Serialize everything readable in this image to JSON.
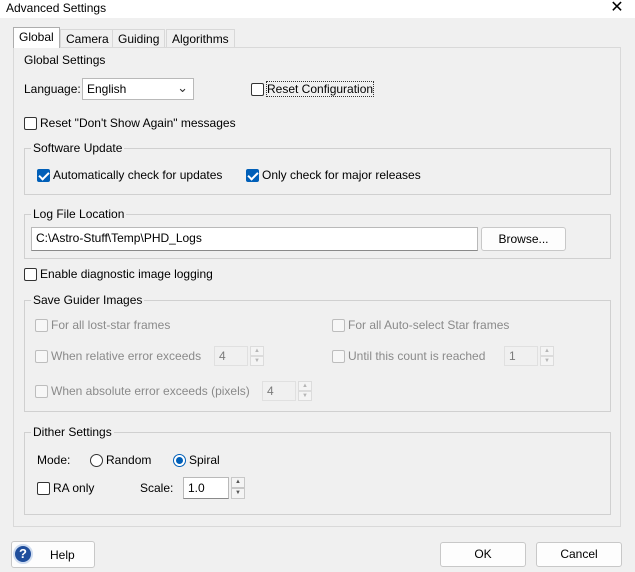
{
  "window": {
    "title": "Advanced Settings",
    "close": "✕"
  },
  "tabs": [
    "Global",
    "Camera",
    "Guiding",
    "Algorithms"
  ],
  "global_settings": {
    "label": "Global Settings",
    "language_label": "Language:",
    "language_value": "English",
    "reset_config": "Reset Configuration",
    "reset_dont_show": "Reset \"Don't Show Again\" messages"
  },
  "software_update": {
    "label": "Software Update",
    "auto_check": "Automatically check for updates",
    "major_only": "Only check for major releases"
  },
  "log_file": {
    "label": "Log File Location",
    "path": "C:\\Astro-Stuff\\Temp\\PHD_Logs",
    "browse": "Browse..."
  },
  "diagnostic": "Enable diagnostic image logging",
  "save_guider": {
    "label": "Save Guider Images",
    "all_lost": "For all lost-star frames",
    "all_auto": "For all Auto-select Star frames",
    "rel_error": "When relative error exceeds",
    "rel_value": "4",
    "until_count": "Until this count is reached",
    "count_value": "1",
    "abs_error": "When absolute error exceeds (pixels)",
    "abs_value": "4"
  },
  "dither": {
    "label": "Dither Settings",
    "mode_label": "Mode:",
    "random": "Random",
    "spiral": "Spiral",
    "ra_only": "RA only",
    "scale_label": "Scale:",
    "scale_value": "1.0"
  },
  "footer": {
    "help": "Help",
    "ok": "OK",
    "cancel": "Cancel",
    "help_glyph": "?"
  },
  "icons": {
    "spin_up": "▲",
    "spin_down": "▼",
    "chevron": "⌄"
  },
  "colors": {
    "accent": "#005fb8",
    "help_icon": "#1f4e9c"
  }
}
